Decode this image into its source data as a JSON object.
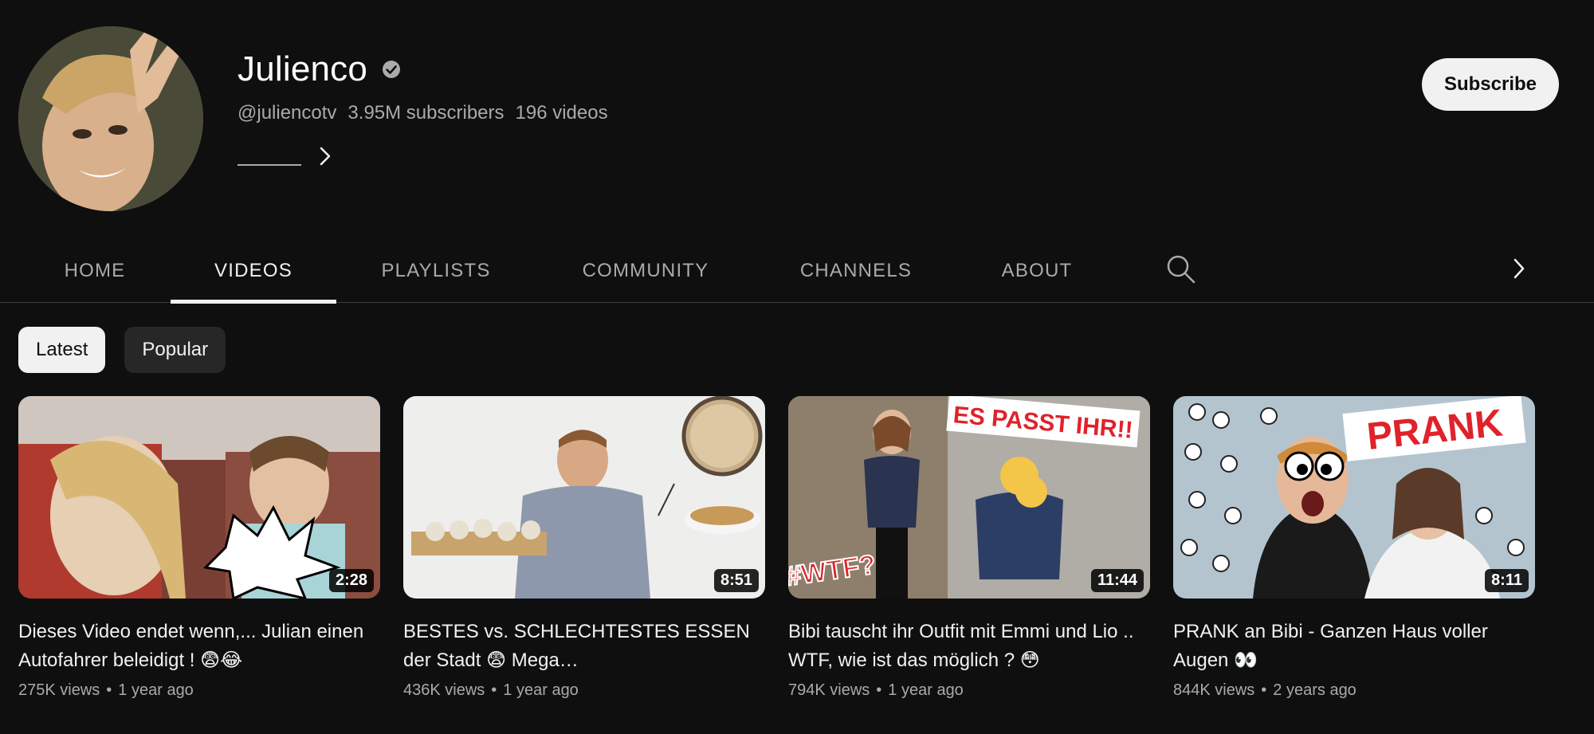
{
  "channel": {
    "name": "Julienco",
    "handle": "@juliencotv",
    "subscribers": "3.95M subscribers",
    "videos_count": "196 videos",
    "subscribe_label": "Subscribe"
  },
  "tabs": [
    {
      "label": "HOME"
    },
    {
      "label": "VIDEOS"
    },
    {
      "label": "PLAYLISTS"
    },
    {
      "label": "COMMUNITY"
    },
    {
      "label": "CHANNELS"
    },
    {
      "label": "ABOUT"
    }
  ],
  "active_tab": "VIDEOS",
  "chips": [
    {
      "label": "Latest"
    },
    {
      "label": "Popular"
    }
  ],
  "videos": [
    {
      "title": "Dieses Video endet wenn,... Julian einen Autofahrer beleidigt ! 😨😂",
      "duration": "2:28",
      "views": "275K views",
      "age": "1 year ago"
    },
    {
      "title": "BESTES vs. SCHLECHTESTES ESSEN der Stadt 😨 Mega…",
      "duration": "8:51",
      "views": "436K views",
      "age": "1 year ago"
    },
    {
      "title": "Bibi tauscht ihr Outfit mit Emmi und Lio .. WTF, wie ist das möglich ? 😳",
      "duration": "11:44",
      "views": "794K views",
      "age": "1 year ago"
    },
    {
      "title": "PRANK an Bibi - Ganzen Haus voller Augen 👀",
      "duration": "8:11",
      "views": "844K views",
      "age": "2 years ago"
    }
  ],
  "thumbnail_text": {
    "v3_banner": "ES PASST IHR!!",
    "v3_tag": "#WTF?",
    "v4_banner": "PRANK"
  },
  "icons": {
    "verified": "verified-badge-icon",
    "search": "search-icon",
    "next": "chevron-right-icon"
  },
  "colors": {
    "background": "#0f0f0f",
    "text_primary": "#f1f1f1",
    "text_secondary": "#aaaaaa"
  }
}
